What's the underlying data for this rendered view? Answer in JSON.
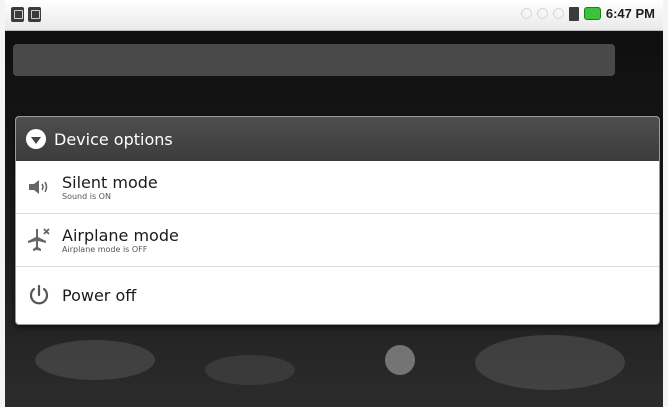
{
  "status_bar": {
    "notification_icons": [
      "usb-icon",
      "usb-debug-icon"
    ],
    "time": "6:47 PM"
  },
  "dialog": {
    "title": "Device options",
    "options": [
      {
        "label": "Silent mode",
        "sublabel": "Sound is ON",
        "icon": "speaker-icon"
      },
      {
        "label": "Airplane mode",
        "sublabel": "Airplane mode is OFF",
        "icon": "airplane-icon"
      },
      {
        "label": "Power off",
        "icon": "power-icon"
      }
    ]
  },
  "colors": {
    "header_bg": "#464646",
    "battery": "#3cc23c",
    "dialog_bg": "#ffffff"
  }
}
